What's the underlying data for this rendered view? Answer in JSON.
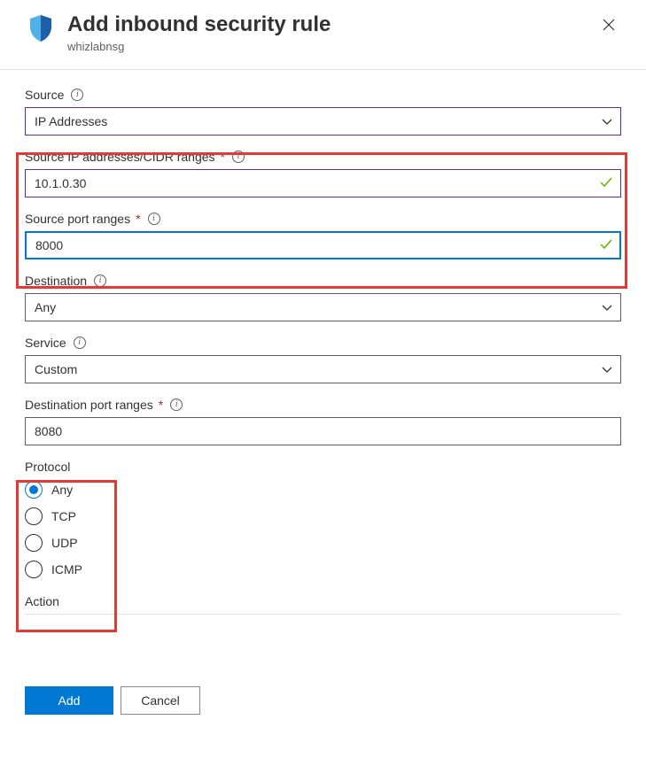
{
  "header": {
    "title": "Add inbound security rule",
    "subtitle": "whizlabnsg"
  },
  "fields": {
    "source": {
      "label": "Source",
      "value": "IP Addresses"
    },
    "sourceIp": {
      "label": "Source IP addresses/CIDR ranges",
      "value": "10.1.0.30"
    },
    "sourcePort": {
      "label": "Source port ranges",
      "value": "8000"
    },
    "destination": {
      "label": "Destination",
      "value": "Any"
    },
    "service": {
      "label": "Service",
      "value": "Custom"
    },
    "destPort": {
      "label": "Destination port ranges",
      "value": "8080"
    },
    "protocol": {
      "label": "Protocol",
      "options": [
        "Any",
        "TCP",
        "UDP",
        "ICMP"
      ],
      "selected": "Any"
    },
    "action": {
      "label": "Action"
    }
  },
  "footer": {
    "add": "Add",
    "cancel": "Cancel"
  }
}
